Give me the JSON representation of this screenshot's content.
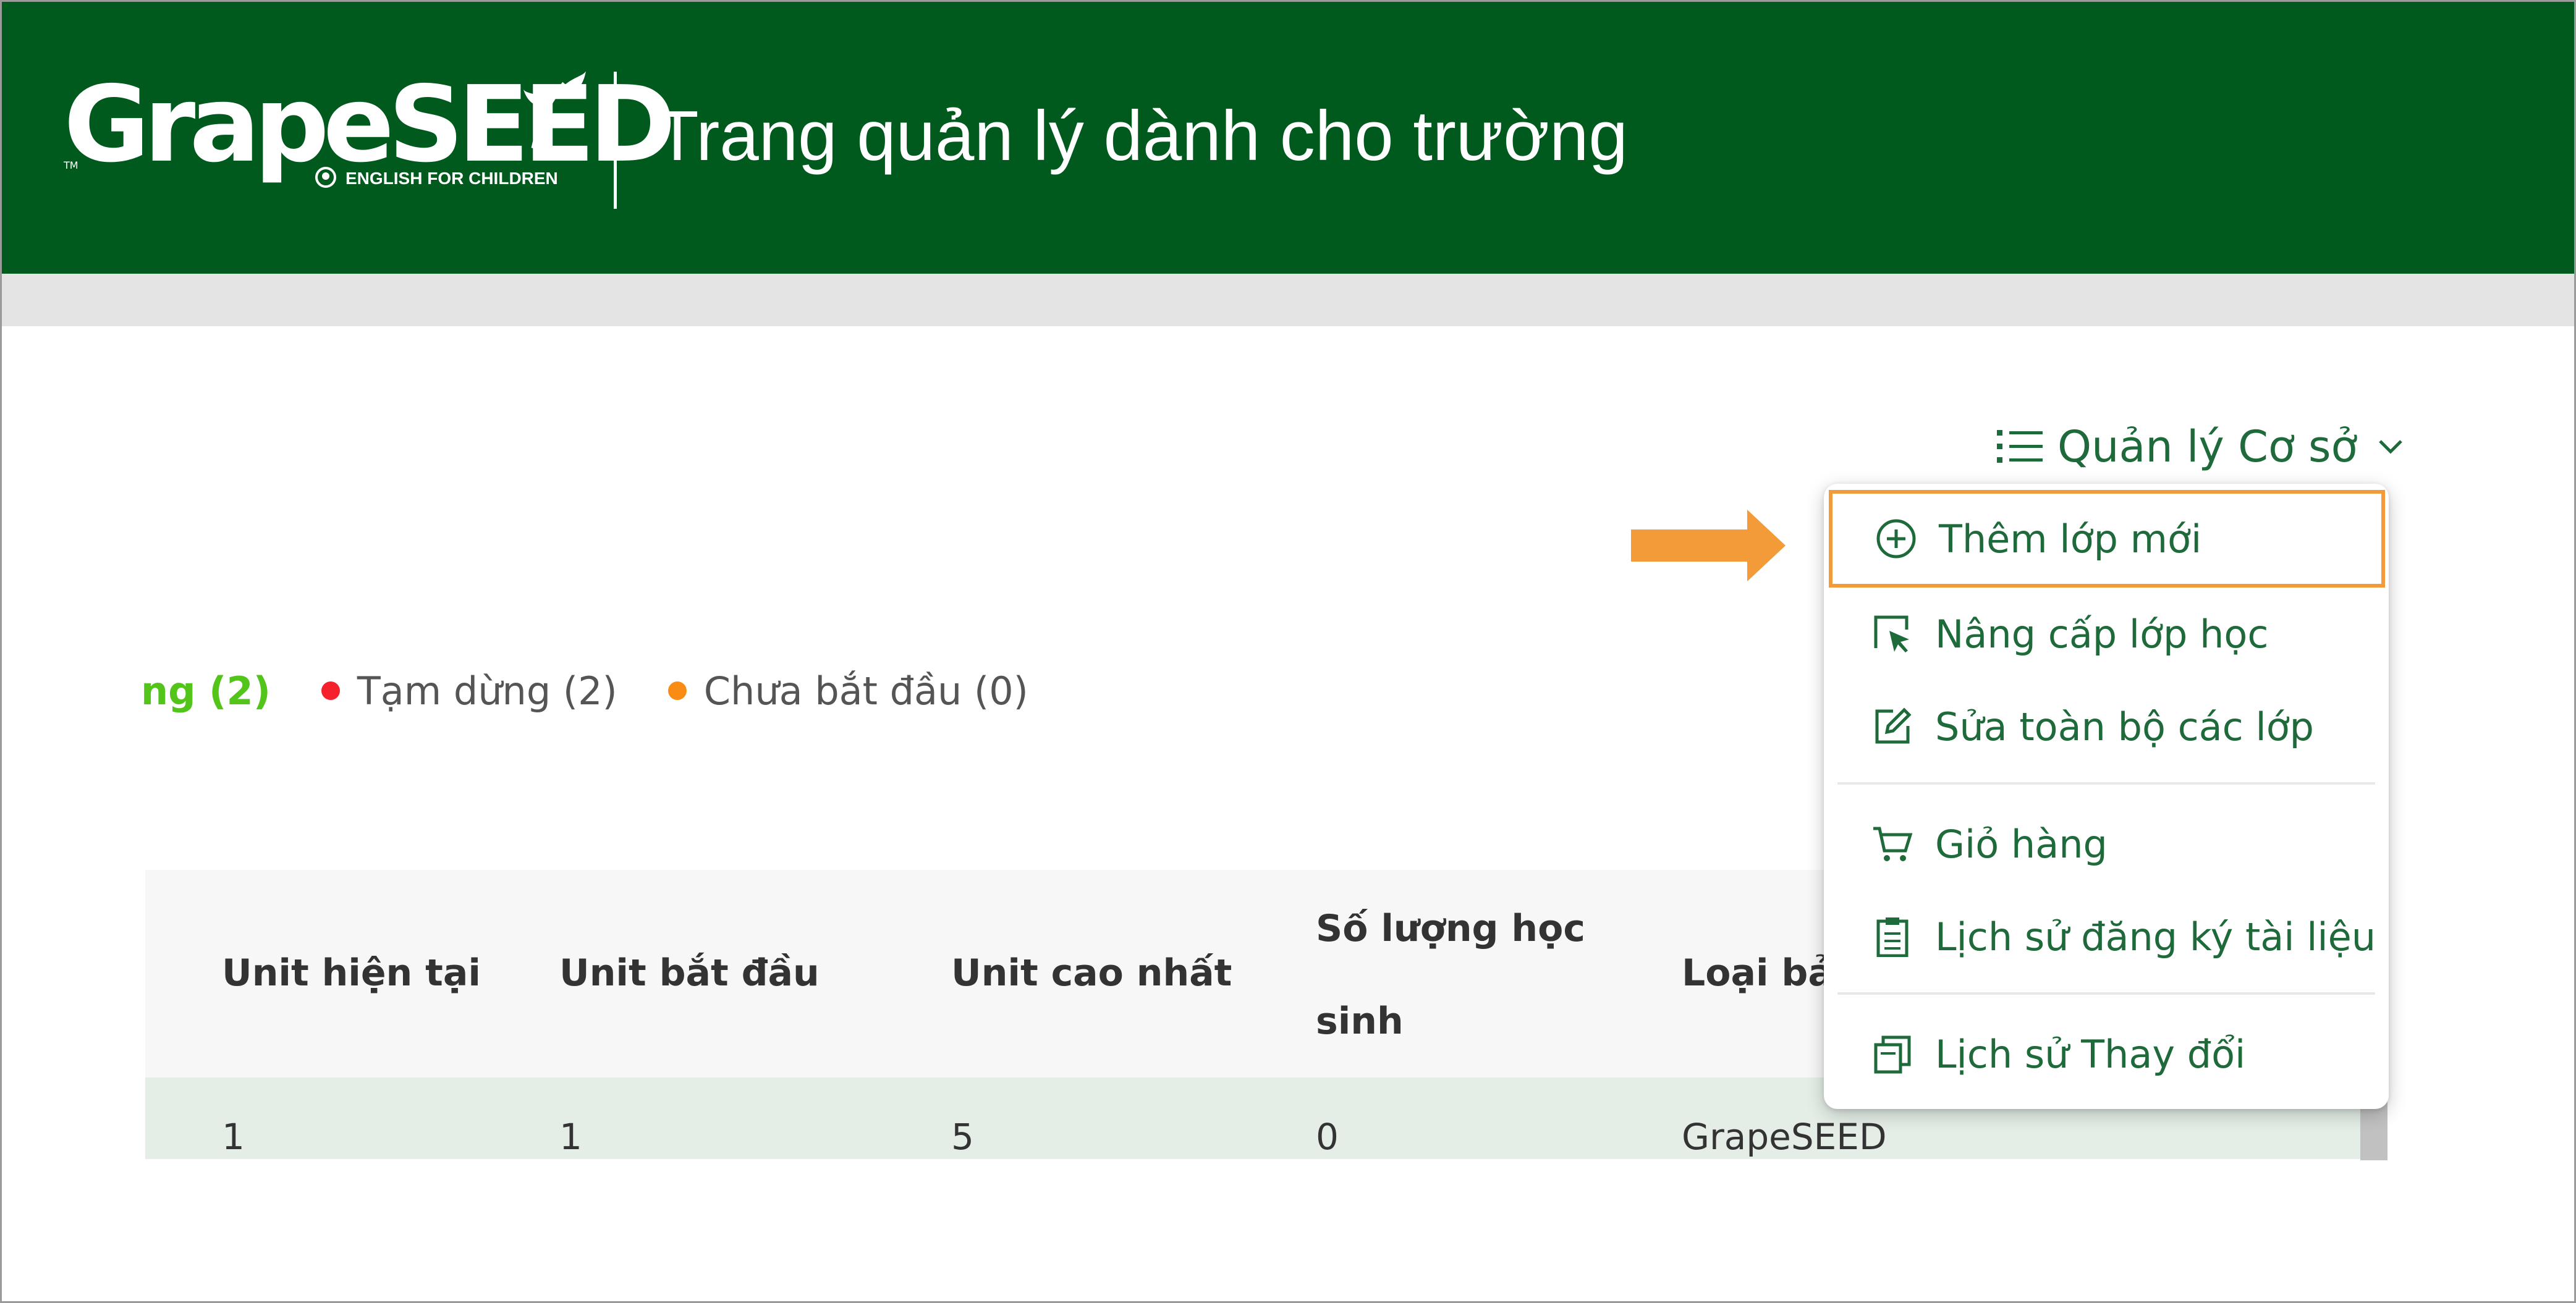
{
  "header": {
    "logo_text": "GrapeSEED",
    "logo_tagline": "ENGLISH FOR CHILDREN",
    "logo_tm": "TM",
    "title": "Trang quản lý dành cho trường"
  },
  "manage_menu": {
    "label": "Quản lý Cơ sở",
    "icon": "list-icon",
    "items": [
      {
        "label": "Thêm lớp mới",
        "icon": "plus-circle-icon",
        "highlighted": true
      },
      {
        "label": "Nâng cấp lớp học",
        "icon": "select-arrow-icon"
      },
      {
        "label": "Sửa toàn bộ các lớp",
        "icon": "edit-icon"
      },
      {
        "label": "Giỏ hàng",
        "icon": "cart-icon"
      },
      {
        "label": "Lịch sử đăng ký tài liệu",
        "icon": "clipboard-icon"
      },
      {
        "label": "Lịch sử Thay đổi",
        "icon": "copy-history-icon"
      }
    ]
  },
  "status_filters": {
    "active_label": "ng (2)",
    "paused_label": "Tạm dừng (2)",
    "not_started_label": "Chưa bắt đầu (0)"
  },
  "colors": {
    "header_bg": "#005a1e",
    "brand_green": "#1f6a3a",
    "active_green": "#52c41a",
    "paused_red": "#f5222d",
    "not_started_orange": "#fa8c16",
    "highlight_orange": "#f29b38"
  },
  "table": {
    "headers": [
      "Unit hiện tại",
      "Unit bắt đầu",
      "Unit cao nhất",
      "Số lượng học",
      "sinh",
      "Loại bả"
    ],
    "row": [
      "1",
      "1",
      "5",
      "0",
      "GrapeSEED"
    ]
  }
}
